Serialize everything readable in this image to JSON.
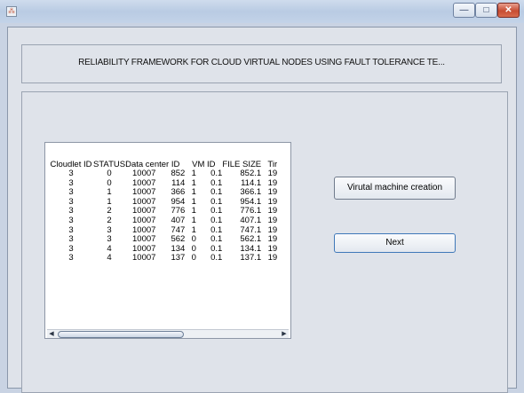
{
  "window": {
    "minimize_glyph": "—",
    "maximize_glyph": "□",
    "close_glyph": "✕",
    "app_icon_glyph": "⁂"
  },
  "header": {
    "title": "RELIABILITY FRAMEWORK FOR CLOUD VIRTUAL NODES USING FAULT TOLERANCE TE..."
  },
  "table": {
    "columns": [
      "Cloudlet ID",
      "STATUS",
      "Data center ID",
      "",
      "VM ID",
      "",
      "FILE SIZE",
      "Tir"
    ],
    "rows": [
      [
        "3",
        "0",
        "10007",
        "852",
        "1",
        "0.1",
        "852.1",
        "19"
      ],
      [
        "3",
        "0",
        "10007",
        "114",
        "1",
        "0.1",
        "114.1",
        "19"
      ],
      [
        "3",
        "1",
        "10007",
        "366",
        "1",
        "0.1",
        "366.1",
        "19"
      ],
      [
        "3",
        "1",
        "10007",
        "954",
        "1",
        "0.1",
        "954.1",
        "19"
      ],
      [
        "3",
        "2",
        "10007",
        "776",
        "1",
        "0.1",
        "776.1",
        "19"
      ],
      [
        "3",
        "2",
        "10007",
        "407",
        "1",
        "0.1",
        "407.1",
        "19"
      ],
      [
        "3",
        "3",
        "10007",
        "747",
        "1",
        "0.1",
        "747.1",
        "19"
      ],
      [
        "3",
        "3",
        "10007",
        "562",
        "0",
        "0.1",
        "562.1",
        "19"
      ],
      [
        "3",
        "4",
        "10007",
        "134",
        "0",
        "0.1",
        "134.1",
        "19"
      ],
      [
        "3",
        "4",
        "10007",
        "137",
        "0",
        "0.1",
        "137.1",
        "19"
      ]
    ]
  },
  "scrollbar": {
    "left_arrow": "◀",
    "right_arrow": "▶"
  },
  "buttons": {
    "vm_creation": "Virutal machine creation",
    "next": "Next"
  }
}
